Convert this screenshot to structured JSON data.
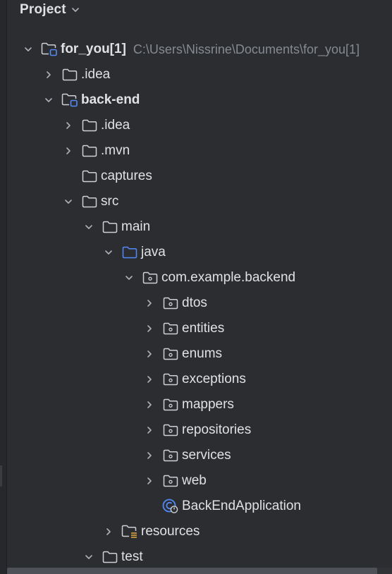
{
  "panel": {
    "title": "Project"
  },
  "tree": [
    {
      "label": "for_you[1]",
      "path": "C:\\Users\\Nissrine\\Documents\\for_you[1]",
      "depth": 0,
      "toggle": "expanded",
      "icon": "module-folder",
      "bold": true
    },
    {
      "label": ".idea",
      "depth": 1,
      "toggle": "collapsed",
      "icon": "folder"
    },
    {
      "label": "back-end",
      "depth": 1,
      "toggle": "expanded",
      "icon": "module-folder",
      "bold": true
    },
    {
      "label": ".idea",
      "depth": 2,
      "toggle": "collapsed",
      "icon": "folder"
    },
    {
      "label": ".mvn",
      "depth": 2,
      "toggle": "collapsed",
      "icon": "folder"
    },
    {
      "label": "captures",
      "depth": 2,
      "toggle": "none",
      "icon": "folder"
    },
    {
      "label": "src",
      "depth": 2,
      "toggle": "expanded",
      "icon": "folder"
    },
    {
      "label": "main",
      "depth": 3,
      "toggle": "expanded",
      "icon": "folder"
    },
    {
      "label": "java",
      "depth": 4,
      "toggle": "expanded",
      "icon": "source-folder"
    },
    {
      "label": "com.example.backend",
      "depth": 5,
      "toggle": "expanded",
      "icon": "package"
    },
    {
      "label": "dtos",
      "depth": 6,
      "toggle": "collapsed",
      "icon": "package"
    },
    {
      "label": "entities",
      "depth": 6,
      "toggle": "collapsed",
      "icon": "package"
    },
    {
      "label": "enums",
      "depth": 6,
      "toggle": "collapsed",
      "icon": "package"
    },
    {
      "label": "exceptions",
      "depth": 6,
      "toggle": "collapsed",
      "icon": "package"
    },
    {
      "label": "mappers",
      "depth": 6,
      "toggle": "collapsed",
      "icon": "package"
    },
    {
      "label": "repositories",
      "depth": 6,
      "toggle": "collapsed",
      "icon": "package"
    },
    {
      "label": "services",
      "depth": 6,
      "toggle": "collapsed",
      "icon": "package"
    },
    {
      "label": "web",
      "depth": 6,
      "toggle": "collapsed",
      "icon": "package"
    },
    {
      "label": "BackEndApplication",
      "depth": 6,
      "toggle": "none",
      "icon": "spring-class"
    },
    {
      "label": "resources",
      "depth": 4,
      "toggle": "collapsed",
      "icon": "resources-folder"
    },
    {
      "label": "test",
      "depth": 3,
      "toggle": "expanded",
      "icon": "folder"
    }
  ],
  "colors": {
    "background": "#2b2d30",
    "text": "#dfe1e5",
    "muted": "#868a91",
    "accent_blue": "#548af7",
    "resource_yellow": "#d9a343"
  }
}
